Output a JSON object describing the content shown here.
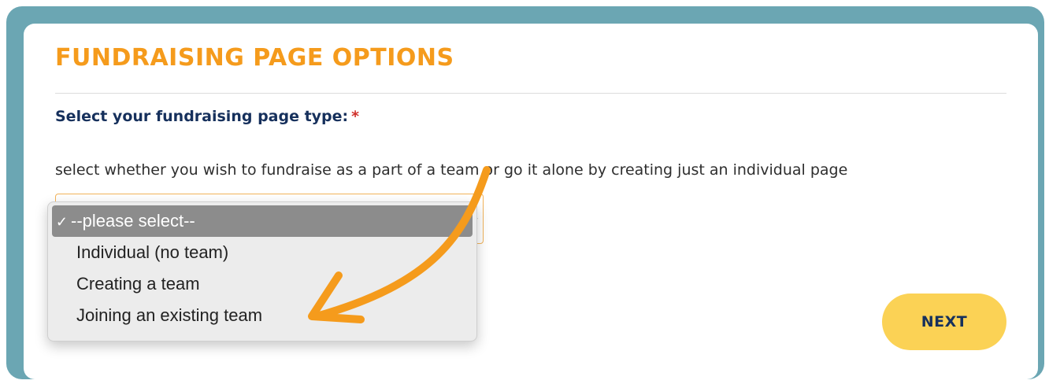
{
  "header": {
    "title": "FUNDRAISING PAGE OPTIONS"
  },
  "form": {
    "label": "Select your fundraising page type:",
    "required_marker": "*",
    "helper_text": "select whether you wish to fundraise as a part of a team or go it alone by creating just an individual page",
    "select": {
      "options": [
        {
          "label": "--please select--",
          "selected": true,
          "check": "✓"
        },
        {
          "label": "Individual (no team)",
          "selected": false
        },
        {
          "label": "Creating a team",
          "selected": false
        },
        {
          "label": "Joining an existing team",
          "selected": false
        }
      ]
    },
    "next_label": "NEXT"
  },
  "colors": {
    "frame": "#6ba6b3",
    "title": "#f59b1c",
    "label": "#16305c",
    "button": "#fbd255",
    "arrow": "#f59b1c"
  }
}
